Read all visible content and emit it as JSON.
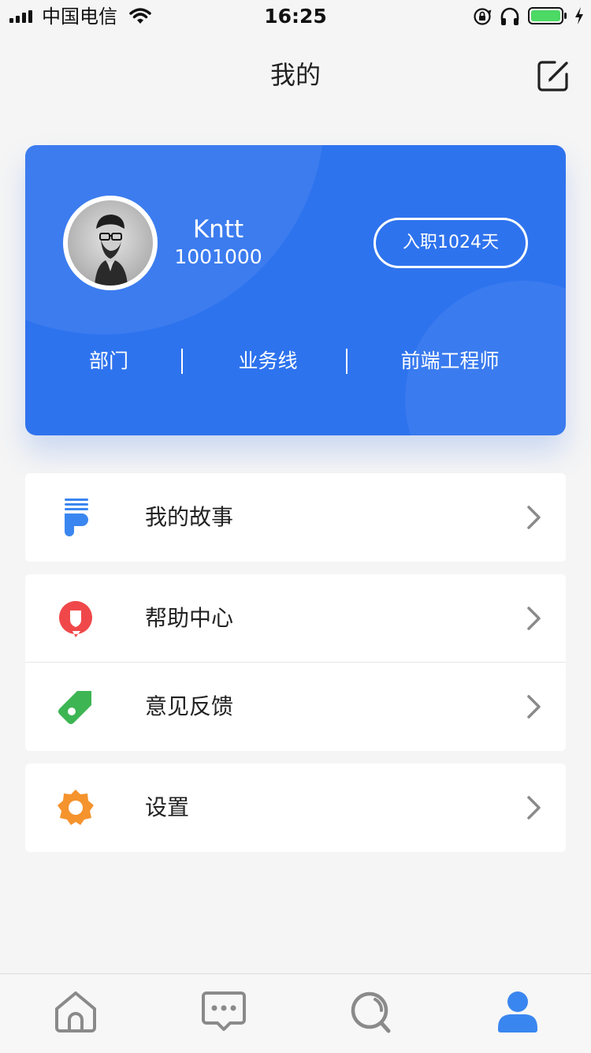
{
  "status_bar": {
    "carrier": "中国电信",
    "time": "16:25",
    "icons": [
      "signal-icon",
      "wifi-icon",
      "rotation-lock-icon",
      "headphone-icon",
      "battery-icon",
      "charging-icon"
    ],
    "battery_color": "#4cd964"
  },
  "header": {
    "title": "我的",
    "edit_icon": "edit-icon"
  },
  "profile": {
    "name": "Kntt",
    "employee_id": "1001000",
    "tenure_label": "入职1024天",
    "department": "部门",
    "business_line": "业务线",
    "position": "前端工程师",
    "card_color": "#2e73ee"
  },
  "menu": {
    "groups": [
      [
        {
          "label": "我的故事",
          "icon": "story-icon",
          "icon_color": "#3a86f0"
        }
      ],
      [
        {
          "label": "帮助中心",
          "icon": "help-icon",
          "icon_color": "#f0484a"
        },
        {
          "label": "意见反馈",
          "icon": "feedback-tag-icon",
          "icon_color": "#3db553"
        }
      ],
      [
        {
          "label": "设置",
          "icon": "settings-gear-icon",
          "icon_color": "#f5932d"
        }
      ]
    ]
  },
  "tab_bar": {
    "tabs": [
      {
        "icon": "home-icon",
        "active": false
      },
      {
        "icon": "message-icon",
        "active": false
      },
      {
        "icon": "discover-icon",
        "active": false
      },
      {
        "icon": "profile-icon",
        "active": true
      }
    ],
    "active_color": "#3a86f0",
    "inactive_color": "#8a8a8a"
  }
}
